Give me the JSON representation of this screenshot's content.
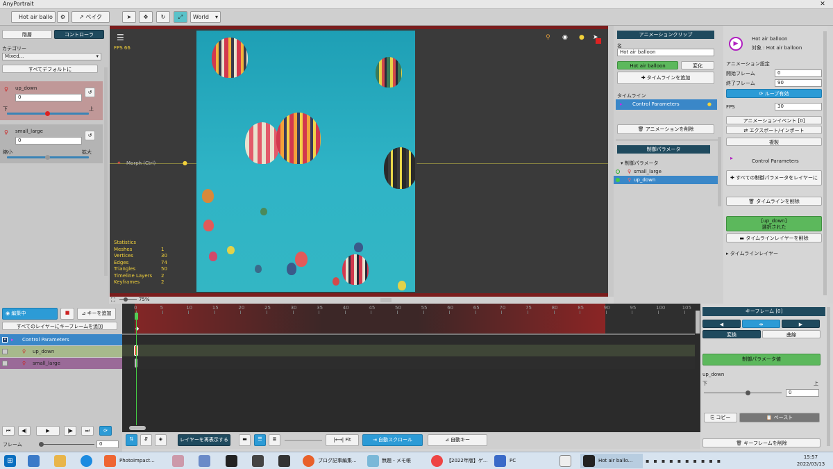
{
  "app": {
    "title": "AnyPortrait"
  },
  "window_controls": {
    "close": "✕"
  },
  "toolbar": {
    "file_name": "Hot air ballo",
    "bake_label": "ベイク",
    "space_select": "World"
  },
  "left_panel": {
    "tab_hierarchy": "階層",
    "tab_controller": "コントローラ",
    "category_label": "カテゴリー",
    "category_value": "Mixed...",
    "all_default_button": "すべてデフォルトに",
    "params": [
      {
        "name": "up_down",
        "value": "0",
        "min_label": "下",
        "max_label": "上",
        "level": 0.5
      },
      {
        "name": "small_large",
        "value": "0",
        "min_label": "縮小",
        "max_label": "拡大",
        "level": 0.5
      }
    ]
  },
  "viewport": {
    "fps": "FPS 66",
    "morph_label": "Morph (Ctrl)",
    "zoom": "75%",
    "stats": {
      "title": "Statistics",
      "rows": [
        {
          "k": "Meshes",
          "v": "1"
        },
        {
          "k": "Vertices",
          "v": "30"
        },
        {
          "k": "Edges",
          "v": "74"
        },
        {
          "k": "Triangles",
          "v": "50"
        },
        {
          "k": "Timeline Layers",
          "v": "2"
        },
        {
          "k": "Keyframes",
          "v": "2"
        }
      ]
    }
  },
  "mid_panel": {
    "clip_header": "アニメーションクリップ",
    "name_label": "名",
    "name_value": "Hot air balloon",
    "clip_button": "Hot air balloon",
    "transform_button": "変化",
    "add_timeline": "タイムラインを追加",
    "timeline_label": "タイムライン",
    "timeline_item": "Control Parameters",
    "delete_anim": "アニメーションを削除",
    "ctrl_params_header": "制御パラメータ",
    "tree_root": "制御パラメータ",
    "tree_items": [
      "small_large",
      "up_down"
    ]
  },
  "right_panel": {
    "anim_title": "Hot air balloon",
    "target_label": "対象 : Hot air balloon",
    "anim_settings": "アニメーション設定",
    "start_frame_label": "開始フレーム",
    "start_frame": "0",
    "end_frame_label": "終了フレーム",
    "end_frame": "90",
    "loop_button": "ループ有効",
    "fps_label": "FPS",
    "fps_value": "30",
    "anim_event": "アニメーションイベント [0]",
    "export_import": "エクスポート/インポート",
    "duplicate": "複製",
    "control_params": "Control Parameters",
    "all_params_to_layer": "すべての制御パラメータをレイヤーに",
    "delete_timeline": "タイムラインを削除",
    "selected_line1": "[up_down]",
    "selected_line2": "選択された",
    "delete_timeline_layer": "タイムラインレイヤーを削除",
    "timeline_layer": "タイムラインレイヤー"
  },
  "bottom_left": {
    "editing": "編集中",
    "add_key": "キーを追加",
    "keyframe_all": "すべてのレイヤーにキーフレームを追加",
    "layers": [
      {
        "name": "Control Parameters"
      },
      {
        "name": "up_down"
      },
      {
        "name": "small_large"
      }
    ],
    "frame_label": "フレーム",
    "frame_value": "0"
  },
  "timeline": {
    "ticks": [
      "0",
      "5",
      "10",
      "15",
      "20",
      "25",
      "30",
      "35",
      "40",
      "45",
      "50",
      "55",
      "60",
      "65",
      "70",
      "75",
      "80",
      "85",
      "90",
      "95",
      "100",
      "105"
    ],
    "refresh_layers": "レイヤーを再表示する",
    "fit": "Fit",
    "auto_scroll": "自動スクロール",
    "auto_key": "自動キー"
  },
  "keyframe_panel": {
    "header": "キーフレーム [0]",
    "transform_tab": "変換",
    "curve_tab": "曲線",
    "param_value_header": "制御パラメータ値",
    "param_name": "up_down",
    "min_label": "下",
    "max_label": "上",
    "value": "0",
    "copy": "コピー",
    "paste": "ペースト",
    "delete_keyframe": "キーフレームを削除"
  },
  "taskbar": {
    "items": [
      "PhotoImpact...",
      "ブログ記事編集...",
      "無題 - メモ帳",
      "【2022年版】ゲ...",
      "PC",
      "Hot air ballo..."
    ],
    "time": "15:57",
    "date": "2022/03/13"
  },
  "colors": {
    "accent": "#2c9bd6",
    "panel_header": "#1f4a5e",
    "green": "#5cb85c",
    "stats": "#f3d23a"
  }
}
